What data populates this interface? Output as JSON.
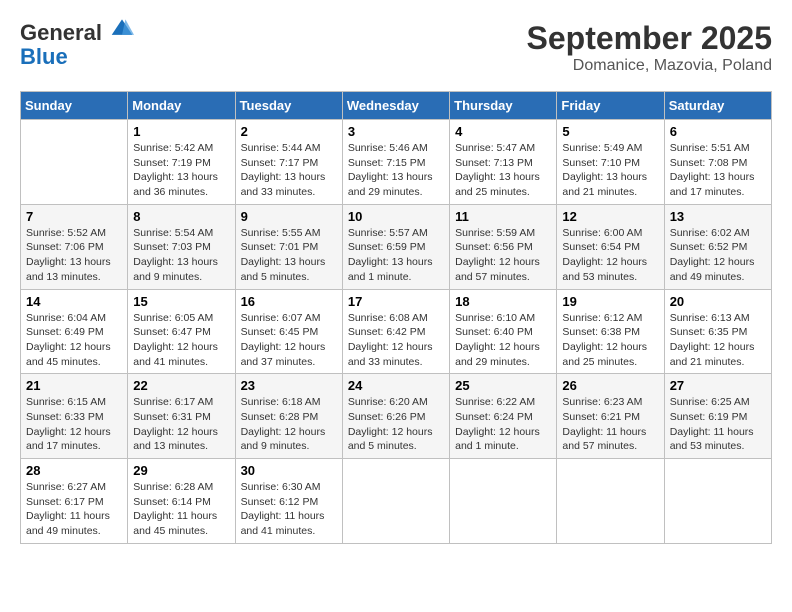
{
  "header": {
    "logo_line1": "General",
    "logo_line2": "Blue",
    "month": "September 2025",
    "location": "Domanice, Mazovia, Poland"
  },
  "weekdays": [
    "Sunday",
    "Monday",
    "Tuesday",
    "Wednesday",
    "Thursday",
    "Friday",
    "Saturday"
  ],
  "rows": [
    [
      {
        "num": "",
        "info": ""
      },
      {
        "num": "1",
        "info": "Sunrise: 5:42 AM\nSunset: 7:19 PM\nDaylight: 13 hours\nand 36 minutes."
      },
      {
        "num": "2",
        "info": "Sunrise: 5:44 AM\nSunset: 7:17 PM\nDaylight: 13 hours\nand 33 minutes."
      },
      {
        "num": "3",
        "info": "Sunrise: 5:46 AM\nSunset: 7:15 PM\nDaylight: 13 hours\nand 29 minutes."
      },
      {
        "num": "4",
        "info": "Sunrise: 5:47 AM\nSunset: 7:13 PM\nDaylight: 13 hours\nand 25 minutes."
      },
      {
        "num": "5",
        "info": "Sunrise: 5:49 AM\nSunset: 7:10 PM\nDaylight: 13 hours\nand 21 minutes."
      },
      {
        "num": "6",
        "info": "Sunrise: 5:51 AM\nSunset: 7:08 PM\nDaylight: 13 hours\nand 17 minutes."
      }
    ],
    [
      {
        "num": "7",
        "info": "Sunrise: 5:52 AM\nSunset: 7:06 PM\nDaylight: 13 hours\nand 13 minutes."
      },
      {
        "num": "8",
        "info": "Sunrise: 5:54 AM\nSunset: 7:03 PM\nDaylight: 13 hours\nand 9 minutes."
      },
      {
        "num": "9",
        "info": "Sunrise: 5:55 AM\nSunset: 7:01 PM\nDaylight: 13 hours\nand 5 minutes."
      },
      {
        "num": "10",
        "info": "Sunrise: 5:57 AM\nSunset: 6:59 PM\nDaylight: 13 hours\nand 1 minute."
      },
      {
        "num": "11",
        "info": "Sunrise: 5:59 AM\nSunset: 6:56 PM\nDaylight: 12 hours\nand 57 minutes."
      },
      {
        "num": "12",
        "info": "Sunrise: 6:00 AM\nSunset: 6:54 PM\nDaylight: 12 hours\nand 53 minutes."
      },
      {
        "num": "13",
        "info": "Sunrise: 6:02 AM\nSunset: 6:52 PM\nDaylight: 12 hours\nand 49 minutes."
      }
    ],
    [
      {
        "num": "14",
        "info": "Sunrise: 6:04 AM\nSunset: 6:49 PM\nDaylight: 12 hours\nand 45 minutes."
      },
      {
        "num": "15",
        "info": "Sunrise: 6:05 AM\nSunset: 6:47 PM\nDaylight: 12 hours\nand 41 minutes."
      },
      {
        "num": "16",
        "info": "Sunrise: 6:07 AM\nSunset: 6:45 PM\nDaylight: 12 hours\nand 37 minutes."
      },
      {
        "num": "17",
        "info": "Sunrise: 6:08 AM\nSunset: 6:42 PM\nDaylight: 12 hours\nand 33 minutes."
      },
      {
        "num": "18",
        "info": "Sunrise: 6:10 AM\nSunset: 6:40 PM\nDaylight: 12 hours\nand 29 minutes."
      },
      {
        "num": "19",
        "info": "Sunrise: 6:12 AM\nSunset: 6:38 PM\nDaylight: 12 hours\nand 25 minutes."
      },
      {
        "num": "20",
        "info": "Sunrise: 6:13 AM\nSunset: 6:35 PM\nDaylight: 12 hours\nand 21 minutes."
      }
    ],
    [
      {
        "num": "21",
        "info": "Sunrise: 6:15 AM\nSunset: 6:33 PM\nDaylight: 12 hours\nand 17 minutes."
      },
      {
        "num": "22",
        "info": "Sunrise: 6:17 AM\nSunset: 6:31 PM\nDaylight: 12 hours\nand 13 minutes."
      },
      {
        "num": "23",
        "info": "Sunrise: 6:18 AM\nSunset: 6:28 PM\nDaylight: 12 hours\nand 9 minutes."
      },
      {
        "num": "24",
        "info": "Sunrise: 6:20 AM\nSunset: 6:26 PM\nDaylight: 12 hours\nand 5 minutes."
      },
      {
        "num": "25",
        "info": "Sunrise: 6:22 AM\nSunset: 6:24 PM\nDaylight: 12 hours\nand 1 minute."
      },
      {
        "num": "26",
        "info": "Sunrise: 6:23 AM\nSunset: 6:21 PM\nDaylight: 11 hours\nand 57 minutes."
      },
      {
        "num": "27",
        "info": "Sunrise: 6:25 AM\nSunset: 6:19 PM\nDaylight: 11 hours\nand 53 minutes."
      }
    ],
    [
      {
        "num": "28",
        "info": "Sunrise: 6:27 AM\nSunset: 6:17 PM\nDaylight: 11 hours\nand 49 minutes."
      },
      {
        "num": "29",
        "info": "Sunrise: 6:28 AM\nSunset: 6:14 PM\nDaylight: 11 hours\nand 45 minutes."
      },
      {
        "num": "30",
        "info": "Sunrise: 6:30 AM\nSunset: 6:12 PM\nDaylight: 11 hours\nand 41 minutes."
      },
      {
        "num": "",
        "info": ""
      },
      {
        "num": "",
        "info": ""
      },
      {
        "num": "",
        "info": ""
      },
      {
        "num": "",
        "info": ""
      }
    ]
  ]
}
